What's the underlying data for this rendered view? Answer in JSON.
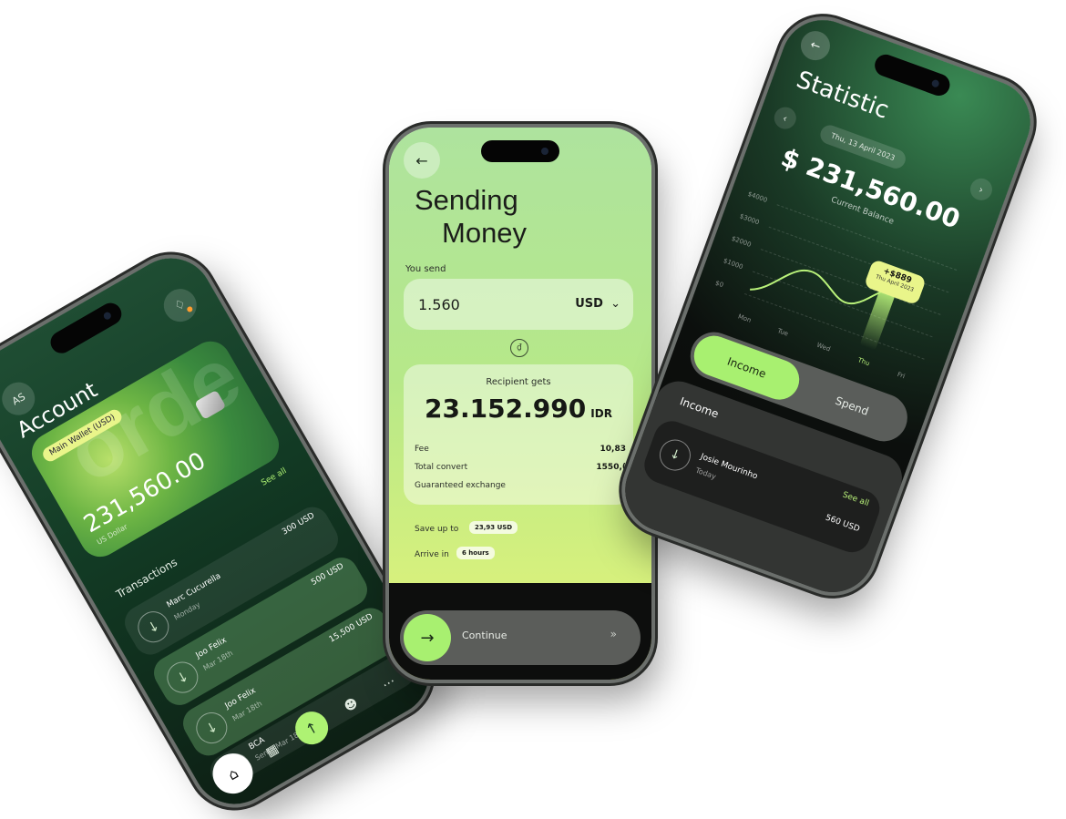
{
  "left_phone": {
    "avatar_initials": "AS",
    "title": "Account",
    "card": {
      "wallet_label": "Main Wallet",
      "wallet_badge": "USD",
      "balance": "231,560.00",
      "currency": "US Dollar"
    },
    "see_all": "See all",
    "transactions_title": "Transactions",
    "transactions": [
      {
        "name": "Marc Cucurella",
        "date": "Monday",
        "amount": "300 USD"
      },
      {
        "name": "Joo Felix",
        "date": "Mar 18th",
        "amount": "500 USD"
      },
      {
        "name": "Joo Felix",
        "date": "Mar 18th",
        "amount": "15,500 USD"
      },
      {
        "name": "BCA",
        "date": "Sent · Mar 18th",
        "amount": ""
      }
    ],
    "nav_icons": [
      "home-icon",
      "calendar-icon",
      "send-icon",
      "users-icon",
      "more-icon"
    ],
    "accent_color": "#aef273"
  },
  "middle_phone": {
    "title_line1": "Sending",
    "title_line2": "Money",
    "you_send_label": "You send",
    "send_amount": "1.560",
    "send_currency": "USD",
    "recipient_label": "Recipient gets",
    "recipient_amount": "23.152.990",
    "recipient_currency": "IDR",
    "details": [
      {
        "label": "Fee",
        "value": "10,83"
      },
      {
        "label": "Total convert",
        "value": "1550,("
      },
      {
        "label": "Guaranteed exchange",
        "value": ""
      }
    ],
    "save_label": "Save up to",
    "save_value": "23,93 USD",
    "arrive_label": "Arrive in",
    "arrive_value": "6 hours",
    "continue_label": "Continue",
    "accent_color": "#b9f27a"
  },
  "right_phone": {
    "title": "Statistic",
    "date": "Thu, 13 April 2023",
    "balance": "$ 231,560.00",
    "balance_label": "Current Balance",
    "y_ticks": [
      "$4000",
      "$3000",
      "$2000",
      "$1000",
      "$0"
    ],
    "x_ticks": [
      "Mon",
      "Tue",
      "Wed",
      "Thu",
      "Fri"
    ],
    "tooltip_value": "+$889",
    "tooltip_date": "Thu April 2023",
    "toggle_income": "Income",
    "toggle_spend": "Spend",
    "section_title": "Income",
    "see_all": "See all",
    "income_item": {
      "name": "Josie Mourinho",
      "date": "Today",
      "amount": "560 USD"
    },
    "accent_color": "#b9f27a"
  }
}
